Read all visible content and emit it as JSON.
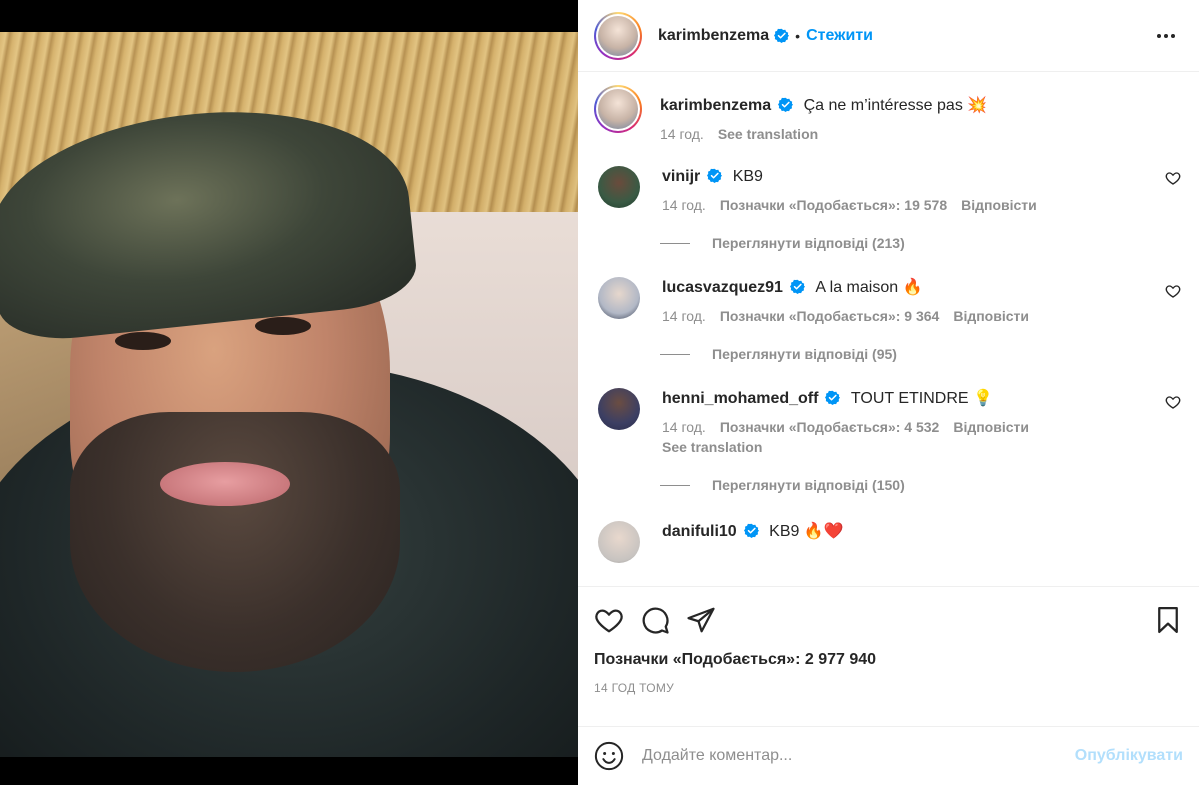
{
  "post": {
    "author": "karimbenzema",
    "follow_label": "Стежити",
    "separator": "•",
    "caption_text": "Ça ne m’intéresse pas",
    "caption_emoji": "💥",
    "caption_time": "14 год.",
    "see_translation": "See translation"
  },
  "comments": [
    {
      "username": "vinijr",
      "text": "KB9",
      "emoji": "",
      "time": "14 год.",
      "likes": "Позначки «Подобається»: 19 578",
      "reply": "Відповісти",
      "see_translation": "",
      "view_replies": "Переглянути відповіді (213)"
    },
    {
      "username": "lucasvazquez91",
      "text": "A la maison",
      "emoji": "🔥",
      "time": "14 год.",
      "likes": "Позначки «Подобається»: 9 364",
      "reply": "Відповісти",
      "see_translation": "",
      "view_replies": "Переглянути відповіді (95)"
    },
    {
      "username": "henni_mohamed_off",
      "text": "TOUT ETINDRE",
      "emoji": "💡",
      "time": "14 год.",
      "likes": "Позначки «Подобається»: 4 532",
      "reply": "Відповісти",
      "see_translation": "See translation",
      "view_replies": "Переглянути відповіді (150)"
    },
    {
      "username": "danifuli10",
      "text": "KB9",
      "emoji": "🔥❤️",
      "time": "",
      "likes": "",
      "reply": "",
      "see_translation": "",
      "view_replies": ""
    }
  ],
  "footer": {
    "likes_total": "Позначки «Подобається»: 2 977 940",
    "time_ago": "14 ГОД ТОМУ",
    "comment_placeholder": "Додайте коментар...",
    "publish_label": "Опублікувати"
  },
  "icons": {
    "like": "heart-icon",
    "comment": "comment-icon",
    "share": "paper-plane-icon",
    "save": "bookmark-icon",
    "emoji": "smiley-icon",
    "more": "more-dots-icon",
    "verified": "verified-badge-icon"
  },
  "colors": {
    "accent": "#0095f6",
    "publish_disabled": "#b2dffc",
    "muted_text": "#8e8e8e",
    "text": "#262626"
  }
}
